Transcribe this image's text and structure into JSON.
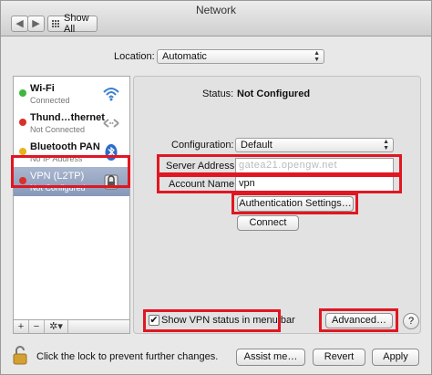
{
  "window": {
    "title": "Network"
  },
  "toolbar": {
    "back": "◀",
    "forward": "▶",
    "show_all": "Show All"
  },
  "location": {
    "label": "Location:",
    "value": "Automatic"
  },
  "services": [
    {
      "name": "Wi-Fi",
      "status": "Connected",
      "dot": "#3db83d",
      "icon": "wifi-icon"
    },
    {
      "name": "Thund…thernet",
      "status": "Not Connected",
      "dot": "#d9302a",
      "icon": "ethernet-arrows-icon"
    },
    {
      "name": "Bluetooth PAN",
      "status": "No IP Address",
      "dot": "#e8b21c",
      "icon": "bluetooth-icon"
    },
    {
      "name": "VPN (L2TP)",
      "status": "Not Configured",
      "dot": "#d9302a",
      "icon": "lock-icon"
    }
  ],
  "sidebar_tools": {
    "add": "+",
    "remove": "−",
    "action": "✲▾"
  },
  "detail": {
    "status_label": "Status:",
    "status_value": "Not Configured",
    "configuration_label": "Configuration:",
    "configuration_value": "Default",
    "server_label": "Server Address:",
    "server_value": "gatea21.opengw.net",
    "account_label": "Account Name:",
    "account_value": "vpn",
    "auth_button": "Authentication Settings…",
    "connect_button": "Connect",
    "show_status_label": "Show VPN status in menu bar",
    "show_status_checked": "✔",
    "advanced_button": "Advanced…",
    "help": "?"
  },
  "footer": {
    "lock_text": "Click the lock to prevent further changes.",
    "assist_button": "Assist me…",
    "revert_button": "Revert",
    "apply_button": "Apply"
  },
  "colors": {
    "highlight": "#e01722",
    "selection": "#8798b8"
  }
}
